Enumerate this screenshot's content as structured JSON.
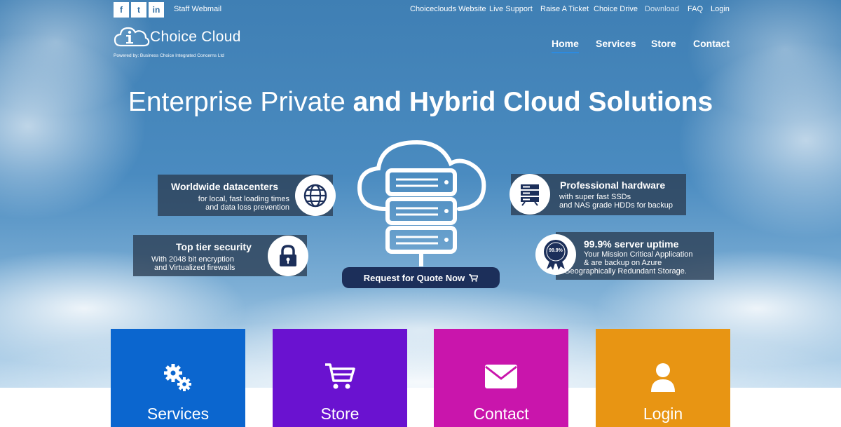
{
  "topbar": {
    "social": [
      "f",
      "t",
      "in"
    ],
    "webmail": "Staff Webmail",
    "links": [
      "Choiceclouds Website",
      "Live Support",
      "Raise A Ticket",
      "Choice Drive",
      "Download",
      "FAQ",
      "Login"
    ]
  },
  "brand": {
    "name": "Choice Cloud",
    "tagline": "Powered by: Business Choice Integrated Concerns Ltd"
  },
  "mainnav": [
    "Home",
    "Services",
    "Store",
    "Contact"
  ],
  "hero": {
    "headline_thin": "Enterprise Private",
    "headline_bold": "and Hybrid Cloud Solutions"
  },
  "features": {
    "datacenters": {
      "title": "Worldwide datacenters",
      "lines": [
        "for local, fast loading times",
        "and data loss prevention"
      ]
    },
    "security": {
      "title": "Top tier security",
      "lines": [
        "With 2048 bit encryption",
        "and Virtualized firewalls"
      ]
    },
    "hardware": {
      "title": "Professional hardware",
      "lines": [
        "with super fast SSDs",
        "and NAS grade HDDs for backup"
      ]
    },
    "uptime": {
      "title": "99.9% server uptime",
      "badge": "99.9%",
      "lines": [
        "Your Mission Critical Application",
        "& are backup on Azure",
        "Geographically Redundant Storage."
      ]
    }
  },
  "cta": {
    "label": "Request for Quote Now"
  },
  "tiles": [
    {
      "label": "Services",
      "color": "#0b66cf",
      "icon": "gears-icon"
    },
    {
      "label": "Store",
      "color": "#6a12d0",
      "icon": "cart-icon"
    },
    {
      "label": "Contact",
      "color": "#c915ac",
      "icon": "envelope-icon"
    },
    {
      "label": "Login",
      "color": "#e89513",
      "icon": "user-icon"
    }
  ],
  "colors": {
    "accent": "#1c2f5a",
    "nav_underline": "#2d8be0"
  }
}
